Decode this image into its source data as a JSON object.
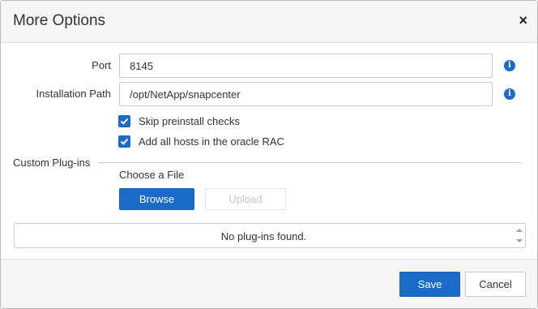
{
  "dialog": {
    "title": "More Options",
    "close_icon": "×"
  },
  "form": {
    "port": {
      "label": "Port",
      "value": "8145",
      "info_icon": "info-icon"
    },
    "installation_path": {
      "label": "Installation Path",
      "value": "/opt/NetApp/snapcenter",
      "info_icon": "info-icon"
    },
    "checkboxes": [
      {
        "label": "Skip preinstall checks",
        "checked": true
      },
      {
        "label": "Add all hosts in the oracle RAC",
        "checked": true
      }
    ]
  },
  "custom_plugins": {
    "section_title": "Custom Plug-ins",
    "choose_file_label": "Choose a File",
    "browse_label": "Browse",
    "upload_label": "Upload",
    "empty_message": "No plug-ins found."
  },
  "footer": {
    "save_label": "Save",
    "cancel_label": "Cancel"
  },
  "colors": {
    "accent": "#1a6cc8",
    "header_bg": "#f5f5f5"
  }
}
